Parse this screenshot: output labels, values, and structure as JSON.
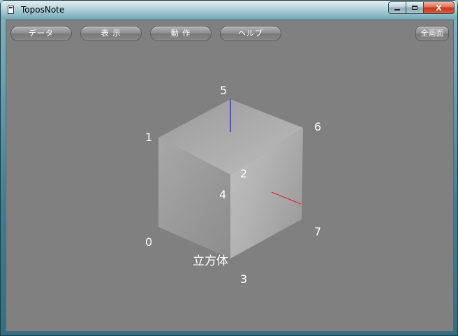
{
  "window": {
    "title": "ToposNote",
    "close_glyph": "X"
  },
  "toolbar": {
    "data_label": "データ",
    "view_label": "表 示",
    "action_label": "動 作",
    "help_label": "ヘルプ",
    "fullscreen_label": "全画面"
  },
  "scene": {
    "shape_name": "立方体",
    "vertex_labels": [
      "0",
      "1",
      "2",
      "3",
      "4",
      "5",
      "6",
      "7"
    ],
    "axis_colors": {
      "blue": "#2020c0",
      "red": "#e02020"
    }
  },
  "icons": [
    "app-window-icon",
    "minimize-icon",
    "maximize-icon",
    "close-icon"
  ]
}
